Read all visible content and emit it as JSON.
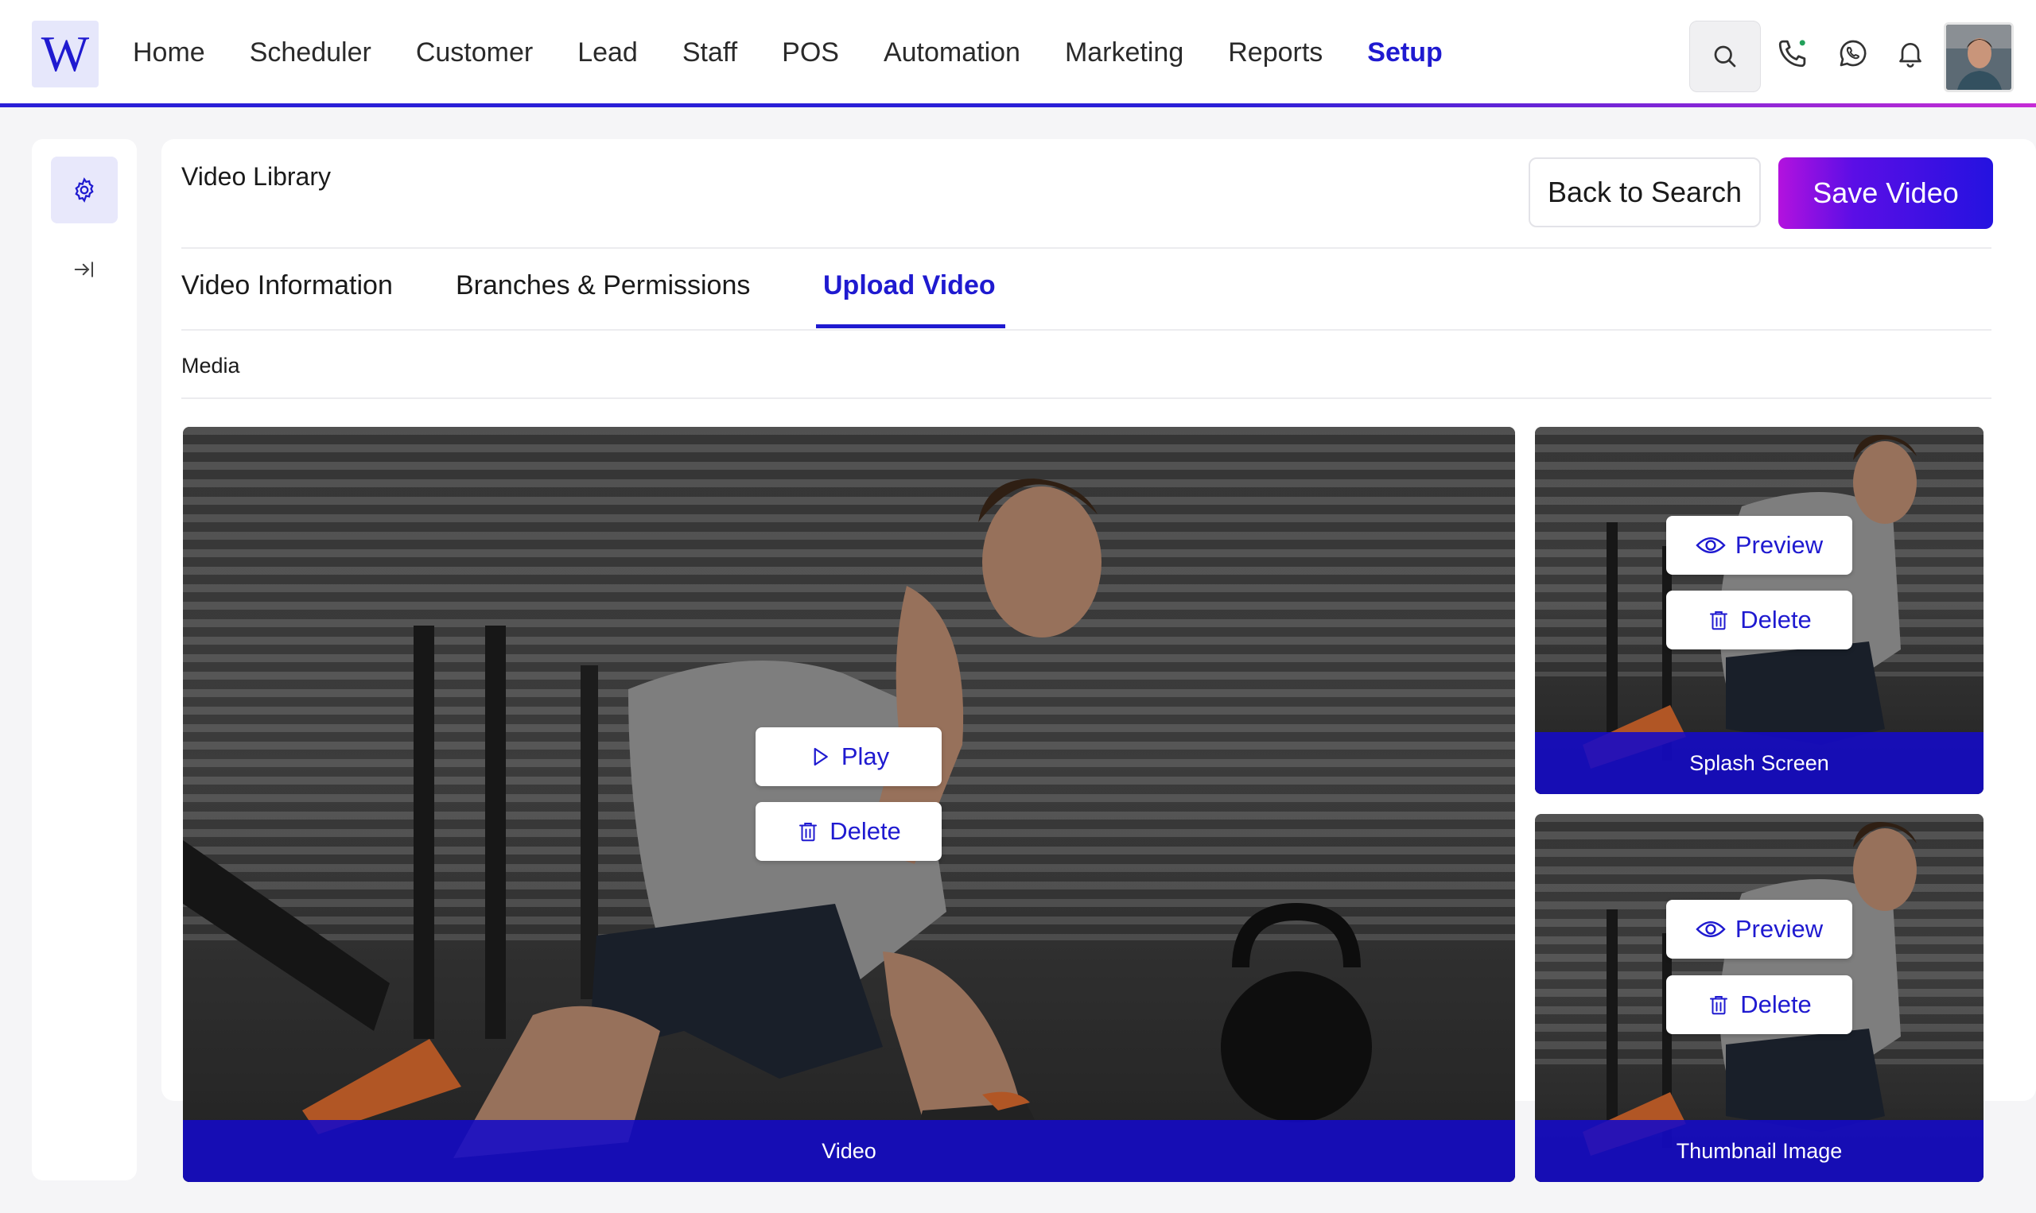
{
  "brand": {
    "logo_letter": "W",
    "accent": "#1f1ad0"
  },
  "nav": {
    "items": [
      {
        "label": "Home",
        "active": false
      },
      {
        "label": "Scheduler",
        "active": false
      },
      {
        "label": "Customer",
        "active": false
      },
      {
        "label": "Lead",
        "active": false
      },
      {
        "label": "Staff",
        "active": false
      },
      {
        "label": "POS",
        "active": false
      },
      {
        "label": "Automation",
        "active": false
      },
      {
        "label": "Marketing",
        "active": false
      },
      {
        "label": "Reports",
        "active": false
      },
      {
        "label": "Setup",
        "active": true
      }
    ],
    "icons": [
      "search-icon",
      "phone-icon",
      "whatsapp-icon",
      "bell-icon"
    ]
  },
  "sidebar": {
    "icons": [
      "gear-icon",
      "collapse-icon"
    ]
  },
  "page": {
    "title": "Video Library",
    "back_label": "Back to Search",
    "save_label": "Save Video",
    "tabs": [
      {
        "label": "Video Information",
        "active": false
      },
      {
        "label": "Branches & Permissions",
        "active": false
      },
      {
        "label": "Upload Video",
        "active": true
      }
    ],
    "section_label": "Media"
  },
  "media": {
    "video": {
      "caption": "Video",
      "play_label": "Play",
      "delete_label": "Delete"
    },
    "splash": {
      "caption": "Splash Screen",
      "preview_label": "Preview",
      "delete_label": "Delete"
    },
    "thumbnail": {
      "caption": "Thumbnail Image",
      "preview_label": "Preview",
      "delete_label": "Delete"
    }
  }
}
